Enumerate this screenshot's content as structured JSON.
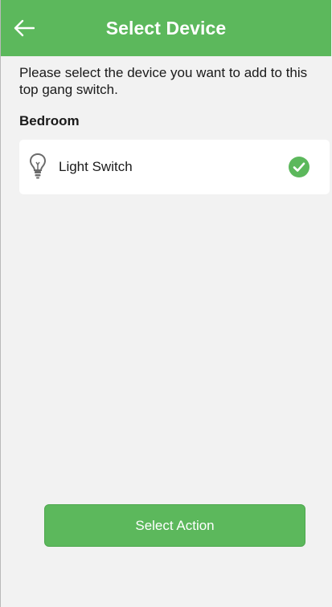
{
  "header": {
    "title": "Select Device",
    "back_icon": "arrow-left-icon"
  },
  "instructions": "Please select the device you want to add to this top gang switch.",
  "room": {
    "name": "Bedroom",
    "devices": [
      {
        "label": "Light Switch",
        "icon": "lightbulb-icon",
        "selected": true,
        "selected_icon": "check-circle-icon"
      }
    ]
  },
  "footer": {
    "action_label": "Select Action"
  },
  "colors": {
    "primary": "#5cb85c",
    "background": "#f2f2f2",
    "card": "#ffffff",
    "text": "#1a1a1a"
  }
}
